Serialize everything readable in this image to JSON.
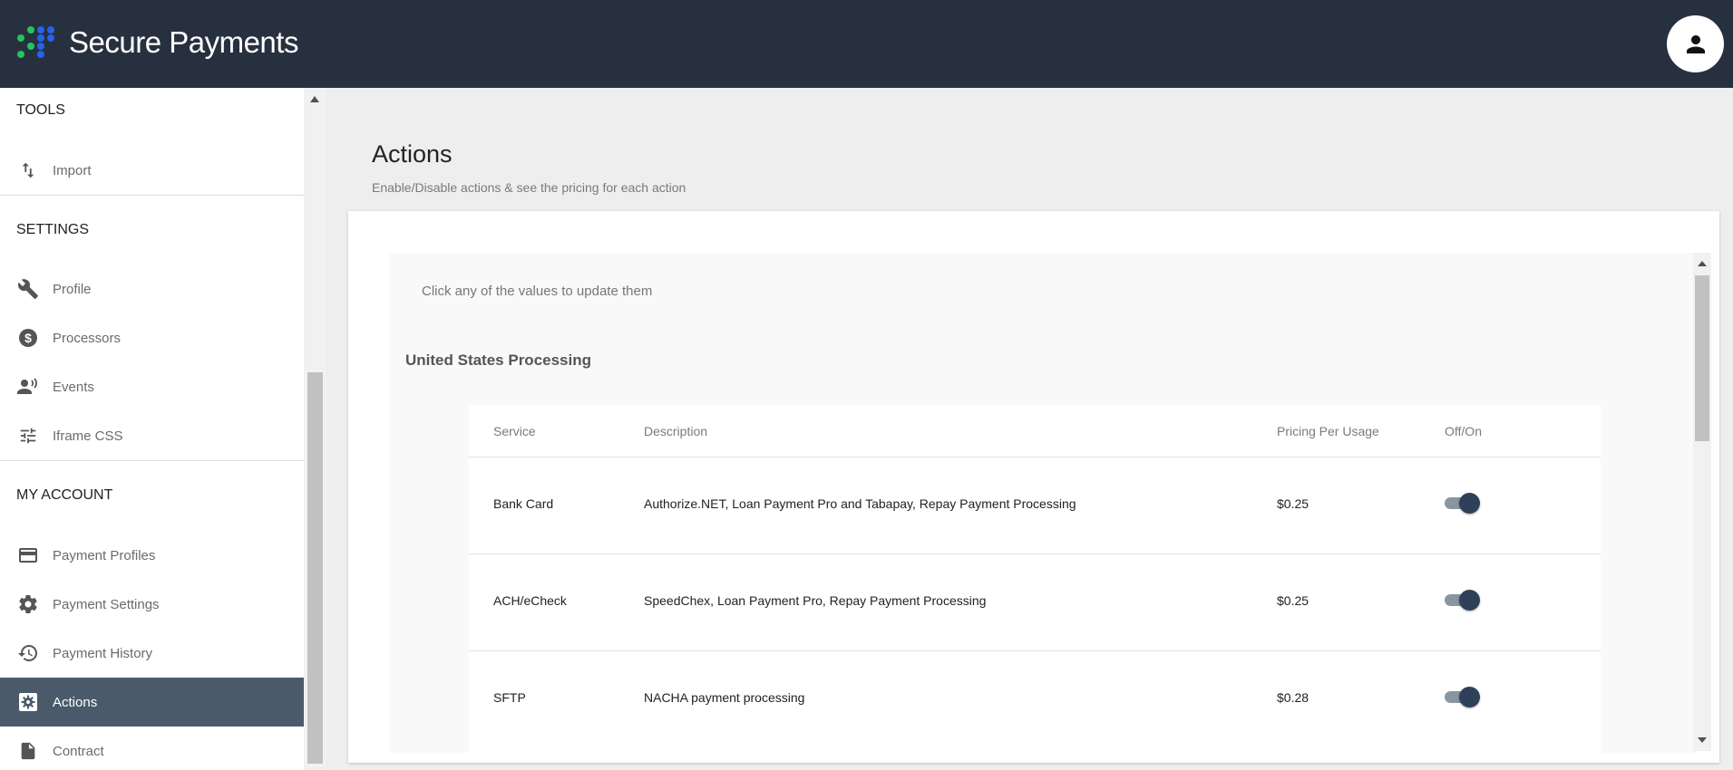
{
  "header": {
    "brand": "Secure Payments",
    "user_icon": "account-circle-icon"
  },
  "sidebar": {
    "sections": [
      {
        "title": "TOOLS",
        "items": [
          {
            "label": "Import",
            "icon": "import-arrows-icon"
          }
        ]
      },
      {
        "title": "SETTINGS",
        "items": [
          {
            "label": "Profile",
            "icon": "wrench-icon"
          },
          {
            "label": "Processors",
            "icon": "dollar-circle-icon"
          },
          {
            "label": "Events",
            "icon": "person-voice-icon"
          },
          {
            "label": "Iframe CSS",
            "icon": "tune-icon"
          }
        ]
      },
      {
        "title": "MY ACCOUNT",
        "items": [
          {
            "label": "Payment Profiles",
            "icon": "credit-card-icon"
          },
          {
            "label": "Payment Settings",
            "icon": "gear-icon"
          },
          {
            "label": "Payment History",
            "icon": "history-icon"
          },
          {
            "label": "Actions",
            "icon": "settings-box-icon",
            "active": true
          },
          {
            "label": "Contract",
            "icon": "document-icon"
          }
        ]
      }
    ]
  },
  "main": {
    "title": "Actions",
    "subtitle": "Enable/Disable actions & see the pricing for each action",
    "hint": "Click any of the values to update them",
    "group_title": "United States Processing",
    "table": {
      "headers": [
        "Service",
        "Description",
        "Pricing Per Usage",
        "Off/On"
      ],
      "rows": [
        {
          "service": "Bank Card",
          "description": "Authorize.NET, Loan Payment Pro and Tabapay, Repay Payment Processing",
          "price": "$0.25",
          "enabled": true
        },
        {
          "service": "ACH/eCheck",
          "description": "SpeedChex, Loan Payment Pro, Repay Payment Processing",
          "price": "$0.25",
          "enabled": true
        },
        {
          "service": "SFTP",
          "description": "NACHA payment processing",
          "price": "$0.28",
          "enabled": true
        }
      ]
    }
  },
  "colors": {
    "header_bg": "#27303f",
    "active_nav_bg": "#4a5a6a",
    "toggle_knob": "#2f4158",
    "logo_green": "#22c55e",
    "logo_blue": "#2563eb"
  }
}
